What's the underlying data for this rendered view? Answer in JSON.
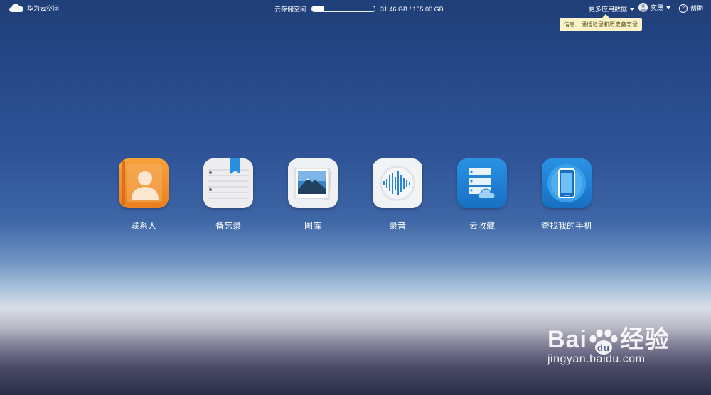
{
  "header": {
    "logo_text": "华为云空间",
    "storage_label": "云存储空间",
    "storage_used_fraction": 0.19,
    "storage_text": "31.46 GB / 165.00 GB",
    "more_apps": "更多应用数据",
    "username": "奕晟",
    "help": "帮助",
    "help_symbol": "?"
  },
  "tooltip": "信息、通话记录和历史备忘录",
  "apps": [
    {
      "label": "联系人",
      "icon": "contacts-icon",
      "color": "#f0912d"
    },
    {
      "label": "备忘录",
      "icon": "notes-icon",
      "color": "#e8e9ec"
    },
    {
      "label": "图库",
      "icon": "gallery-icon",
      "color": "#eef0f3"
    },
    {
      "label": "录音",
      "icon": "recorder-icon",
      "color": "#f2f3f5"
    },
    {
      "label": "云收藏",
      "icon": "cloud-favorites-icon",
      "color": "#1f86d8"
    },
    {
      "label": "查找我的手机",
      "icon": "find-phone-icon",
      "color": "#1f86d8"
    }
  ],
  "watermark": {
    "brand_a": "Bai",
    "brand_b": "du",
    "brand_c": "经验",
    "url": "jingyan.baidu.com"
  }
}
